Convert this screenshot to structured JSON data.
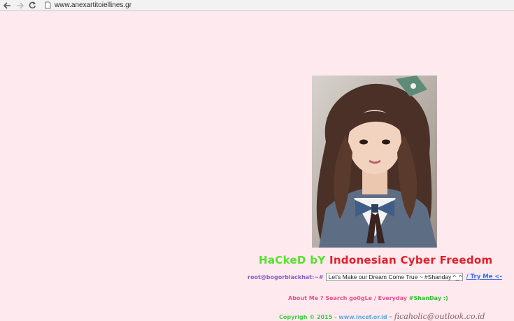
{
  "browser": {
    "url": "www.anexartitoiellines.gr",
    "icons": [
      "back-arrow-icon",
      "forward-arrow-icon",
      "reload-icon",
      "page-icon"
    ]
  },
  "headline": {
    "part1": "HaCkeD bY",
    "part2": "Indonesian Cyber Freedom"
  },
  "console": {
    "prompt": "root@bogorblackhat:~#",
    "input_value": "Let's Make our Dream Come True ~ #Shanday ^_^",
    "link_label": "/ Try Me <-"
  },
  "menu": {
    "text_a": "About Me ? Search go0gLe / Everyday",
    "text_b": "#ShanDay :)"
  },
  "footer": {
    "copyright": "Copyrigh © 2015 -",
    "site": "www.incef.or.id",
    "signature": "- ficaholic@outlook.co.id"
  },
  "colors": {
    "background": "#fde9ee",
    "headline_green": "#55e02a",
    "headline_red": "#e0202a",
    "prompt_purple": "#8a5cc8",
    "link_blue": "#3a6fe8"
  }
}
